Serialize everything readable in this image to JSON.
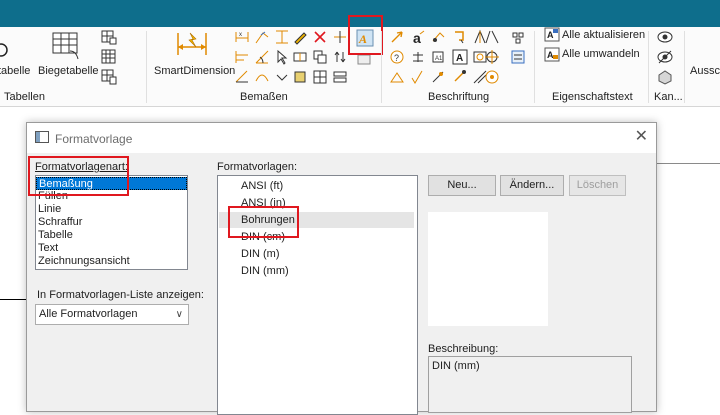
{
  "ribbon": {
    "buttons": {
      "tabelle_partial": "tabelle",
      "biegetabelle": "Biegetabelle",
      "smartdimension": "SmartDimension",
      "alle_aktualisieren": "Alle aktualisieren",
      "alle_umwandeln": "Alle umwandeln",
      "ausschn_partial": "Ausschn"
    },
    "groups": {
      "tabellen": "Tabellen",
      "bemassen": "Bemaßen",
      "beschriftung": "Beschriftung",
      "eigenschaftstext": "Eigenschaftstext",
      "kan": "Kan..."
    }
  },
  "dialog": {
    "title": "Formatvorlage",
    "close": "✕",
    "formatvorlagenart_label": "Formatvorlagenart:",
    "formatvorlagenart_items": [
      "Bemaßung",
      "Füllen",
      "Linie",
      "Schraffur",
      "Tabelle",
      "Text",
      "Zeichnungsansicht"
    ],
    "formatvorlagenart_selected": "Bemaßung",
    "liste_label": "In Formatvorlagen-Liste anzeigen:",
    "liste_value": "Alle Formatvorlagen",
    "formatvorlagen_label": "Formatvorlagen:",
    "formatvorlagen_items": [
      "ANSI (ft)",
      "ANSI (in)",
      "Bohrungen",
      "DIN (cm)",
      "DIN (m)",
      "DIN (mm)"
    ],
    "formatvorlagen_highlighted": "Bohrungen",
    "buttons": {
      "neu": "Neu...",
      "aendern": "Ändern...",
      "loeschen": "Löschen"
    },
    "beschreibung_label": "Beschreibung:",
    "beschreibung_value": "DIN (mm)"
  },
  "colors": {
    "titlebar": "#0e6e8c",
    "highlight_red": "#e0181f",
    "selection": "#0078d7"
  }
}
